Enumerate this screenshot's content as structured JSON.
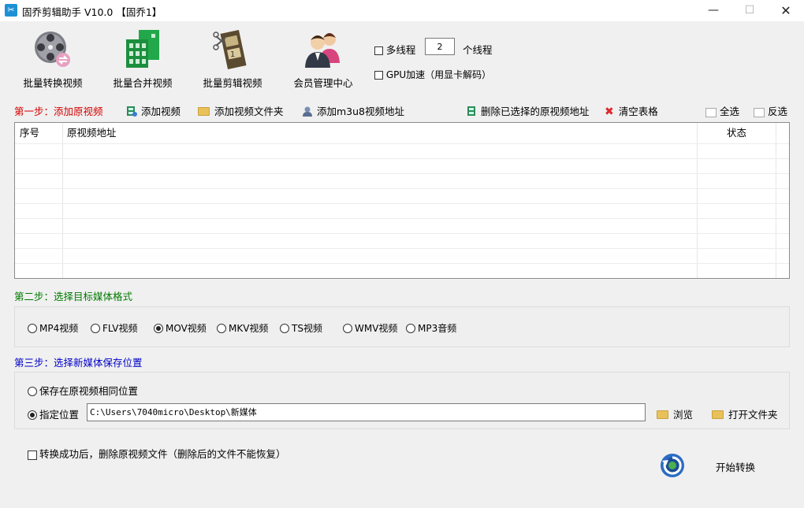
{
  "window": {
    "title": "固乔剪辑助手 V10.0 【固乔1】"
  },
  "toolbar": {
    "batch_convert": "批量转换视频",
    "batch_merge": "批量合并视频",
    "batch_cut": "批量剪辑视频",
    "member_center": "会员管理中心",
    "multithread_label": "多线程",
    "thread_count": "2",
    "thread_unit": "个线程",
    "gpu_label": "GPU加速（用显卡解码）"
  },
  "step1": {
    "label": "第一步：添加原视频",
    "add_video": "添加视频",
    "add_folder": "添加视频文件夹",
    "add_m3u8": "添加m3u8视频地址",
    "delete_selected": "删除已选择的原视频地址",
    "clear_table": "清空表格",
    "select_all": "全选",
    "invert_select": "反选"
  },
  "table": {
    "columns": [
      "序号",
      "原视频地址",
      "状态"
    ],
    "rows": []
  },
  "step2": {
    "label": "第二步：选择目标媒体格式",
    "formats": [
      "MP4视频",
      "FLV视频",
      "MOV视频",
      "MKV视频",
      "TS视频",
      "WMV视频",
      "MP3音频"
    ],
    "selected": "MOV视频"
  },
  "step3": {
    "label": "第三步：选择新媒体保存位置",
    "same_location": "保存在原视频相同位置",
    "specified_location": "指定位置",
    "path": "C:\\Users\\7040micro\\Desktop\\新媒体",
    "browse": "浏览",
    "open_folder": "打开文件夹"
  },
  "footer": {
    "delete_original": "转换成功后，删除原视频文件（删除后的文件不能恢复）",
    "start": "开始转换"
  },
  "colors": {
    "step1_label": "#d40000",
    "step2_label": "#007a00",
    "step3_label": "#0000c8"
  }
}
